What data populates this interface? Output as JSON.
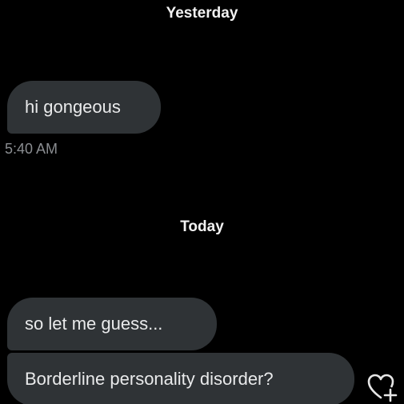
{
  "conversation": {
    "groups": [
      {
        "date_label": "Yesterday",
        "messages": [
          {
            "text": "hi gongeous",
            "time": "5:40 AM"
          }
        ]
      },
      {
        "date_label": "Today",
        "messages": [
          {
            "text": "so let me guess..."
          },
          {
            "text": "Borderline personality disorder?"
          }
        ]
      }
    ]
  },
  "icons": {
    "react": "heart-plus-icon"
  },
  "colors": {
    "background": "#000000",
    "bubble": "#2f3336",
    "timestamp": "#8a8d91"
  }
}
